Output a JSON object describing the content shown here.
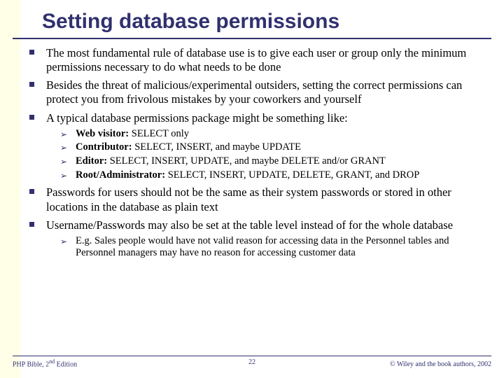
{
  "title": "Setting database permissions",
  "bullets": {
    "b1": "The most fundamental rule of database use is to give each user or group only the minimum permissions necessary to do what needs to be done",
    "b2": "Besides the threat of malicious/experimental outsiders, setting the correct permissions can protect you from frivolous mistakes by your coworkers and yourself",
    "b3": "A typical database permissions package might be something like:",
    "b4": "Passwords for users should not be the same as their system passwords or stored in other locations in the database as plain text",
    "b5": "Username/Passwords may also be set at the table level instead of for the whole database"
  },
  "roles": {
    "r1": {
      "label": "Web visitor:",
      "perms": " SELECT only"
    },
    "r2": {
      "label": "Contributor:",
      "perms": "  SELECT, INSERT, and maybe UPDATE"
    },
    "r3": {
      "label": "Editor:",
      "perms": "  SELECT, INSERT, UPDATE, and maybe DELETE and/or GRANT"
    },
    "r4": {
      "label": "Root/Administrator:",
      "perms": "  SELECT, INSERT, UPDATE, DELETE, GRANT, and DROP"
    }
  },
  "examples": {
    "e1": "E.g. Sales people would have not valid reason for accessing data in the Personnel tables and Personnel managers may have no reason for accessing customer data"
  },
  "footer": {
    "left_prefix": "PHP Bible, 2",
    "left_suffix": "nd",
    "left_tail": " Edition",
    "page": "22",
    "right": "© Wiley and the book authors, 2002"
  }
}
